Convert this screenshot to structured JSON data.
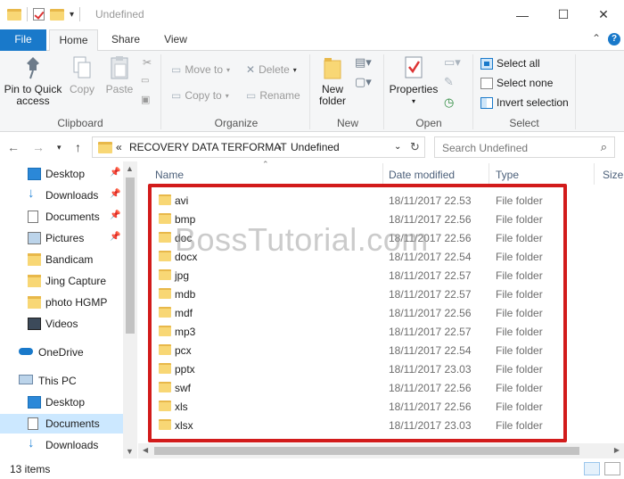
{
  "window": {
    "title": "Undefined",
    "minimize": "—",
    "maximize": "☐",
    "close": "✕"
  },
  "tabs": {
    "file": "File",
    "home": "Home",
    "share": "Share",
    "view": "View"
  },
  "ribbon": {
    "clipboard": {
      "pin": "Pin to Quick access",
      "copy": "Copy",
      "paste": "Paste",
      "label": "Clipboard"
    },
    "organize": {
      "move_to": "Move to",
      "copy_to": "Copy to",
      "delete": "Delete",
      "rename": "Rename",
      "label": "Organize"
    },
    "new": {
      "new_folder": "New folder",
      "label": "New"
    },
    "open": {
      "properties": "Properties",
      "label": "Open"
    },
    "select": {
      "select_all": "Select all",
      "select_none": "Select none",
      "invert": "Invert selection",
      "label": "Select"
    }
  },
  "address": {
    "chevron": "«",
    "crumb1": "RECOVERY DATA TERFORMAT",
    "sep": "›",
    "crumb2": "Undefined",
    "search_placeholder": "Search Undefined"
  },
  "nav": {
    "items": [
      {
        "label": "Desktop",
        "pinned": true,
        "icon": "desktop-icon"
      },
      {
        "label": "Downloads",
        "pinned": true,
        "icon": "download-icon"
      },
      {
        "label": "Documents",
        "pinned": true,
        "icon": "documents-icon"
      },
      {
        "label": "Pictures",
        "pinned": true,
        "icon": "pictures-icon"
      },
      {
        "label": "Bandicam",
        "pinned": false,
        "icon": "folder-icon"
      },
      {
        "label": "Jing Capture",
        "pinned": false,
        "icon": "folder-icon"
      },
      {
        "label": "photo HGMP",
        "pinned": false,
        "icon": "folder-icon"
      },
      {
        "label": "Videos",
        "pinned": false,
        "icon": "videos-icon"
      },
      {
        "label": "OneDrive",
        "pinned": false,
        "icon": "onedrive-icon"
      },
      {
        "label": "This PC",
        "pinned": false,
        "icon": "this-pc-icon"
      },
      {
        "label": "Desktop",
        "pinned": false,
        "icon": "desktop-icon"
      },
      {
        "label": "Documents",
        "pinned": false,
        "icon": "documents-icon"
      },
      {
        "label": "Downloads",
        "pinned": false,
        "icon": "download-icon"
      }
    ]
  },
  "columns": {
    "name": "Name",
    "date": "Date modified",
    "type": "Type",
    "size": "Size"
  },
  "files": [
    {
      "name": "avi",
      "date": "18/11/2017 22.53",
      "type": "File folder"
    },
    {
      "name": "bmp",
      "date": "18/11/2017 22.56",
      "type": "File folder"
    },
    {
      "name": "doc",
      "date": "18/11/2017 22.56",
      "type": "File folder"
    },
    {
      "name": "docx",
      "date": "18/11/2017 22.54",
      "type": "File folder"
    },
    {
      "name": "jpg",
      "date": "18/11/2017 22.57",
      "type": "File folder"
    },
    {
      "name": "mdb",
      "date": "18/11/2017 22.57",
      "type": "File folder"
    },
    {
      "name": "mdf",
      "date": "18/11/2017 22.56",
      "type": "File folder"
    },
    {
      "name": "mp3",
      "date": "18/11/2017 22.57",
      "type": "File folder"
    },
    {
      "name": "pcx",
      "date": "18/11/2017 22.54",
      "type": "File folder"
    },
    {
      "name": "pptx",
      "date": "18/11/2017 23.03",
      "type": "File folder"
    },
    {
      "name": "swf",
      "date": "18/11/2017 22.56",
      "type": "File folder"
    },
    {
      "name": "xls",
      "date": "18/11/2017 22.56",
      "type": "File folder"
    },
    {
      "name": "xlsx",
      "date": "18/11/2017 23.03",
      "type": "File folder"
    }
  ],
  "watermark": "BossTutorial.com",
  "status": {
    "count": "13 items"
  },
  "colors": {
    "accent": "#1979ca",
    "highlight_box": "#d21b1b",
    "folder": "#f8d775"
  }
}
